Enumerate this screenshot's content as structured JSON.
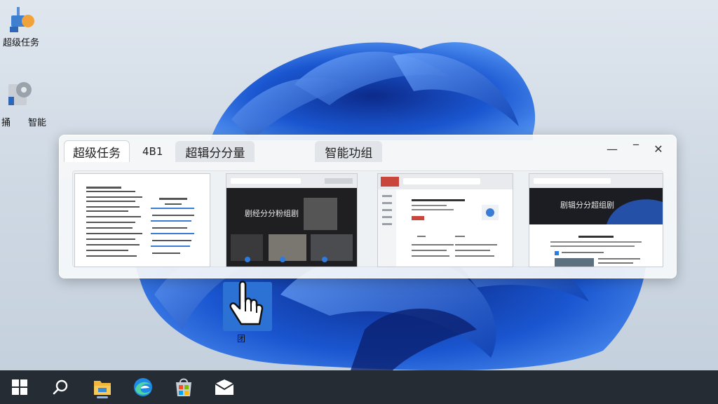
{
  "desktop": {
    "icon1_label": "超级任务",
    "icon2_left_label": "捅",
    "icon2_right_label": "智能"
  },
  "switcher": {
    "tabs": [
      {
        "label": "超级任务",
        "state": "active"
      },
      {
        "label": "4B1",
        "state": "plain"
      },
      {
        "label": "超辑分分量",
        "state": "mid"
      },
      {
        "label": "智能功组",
        "state": "mid"
      }
    ],
    "controls": {
      "minimize": "—",
      "restore": "‾",
      "close": "✕"
    },
    "thumbnails": [
      {
        "kind": "document"
      },
      {
        "kind": "dark-gallery",
        "headline": "剧经分分粉组剧"
      },
      {
        "kind": "web-app"
      },
      {
        "kind": "web-article",
        "headline": "剧辑分分超组剧"
      }
    ]
  },
  "cursor": {
    "caption": "团"
  },
  "taskbar": {
    "items": [
      "start-icon",
      "search-icon",
      "file-explorer-icon",
      "edge-icon",
      "store-icon",
      "mail-icon"
    ]
  },
  "colors": {
    "taskbar": "#262c33",
    "accent": "#1e6fd9",
    "wallpaper_blue": "#1f5fd6"
  }
}
